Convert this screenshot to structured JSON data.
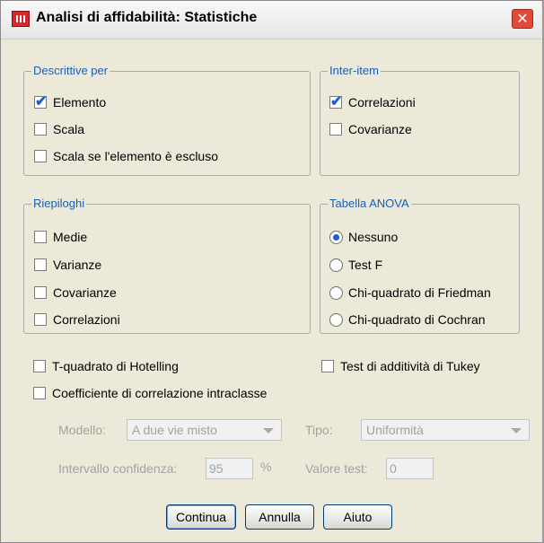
{
  "window": {
    "title": "Analisi di affidabilità: Statistiche"
  },
  "groups": {
    "descrittive": {
      "legend": "Descrittive per",
      "items": [
        {
          "label": "Elemento",
          "checked": true
        },
        {
          "label": "Scala",
          "checked": false
        },
        {
          "label": "Scala se l'elemento è escluso",
          "checked": false
        }
      ]
    },
    "interitem": {
      "legend": "Inter-item",
      "items": [
        {
          "label": "Correlazioni",
          "checked": true
        },
        {
          "label": "Covarianze",
          "checked": false
        }
      ]
    },
    "riepiloghi": {
      "legend": "Riepiloghi",
      "items": [
        {
          "label": "Medie",
          "checked": false
        },
        {
          "label": "Varianze",
          "checked": false
        },
        {
          "label": "Covarianze",
          "checked": false
        },
        {
          "label": "Correlazioni",
          "checked": false
        }
      ]
    },
    "anova": {
      "legend": "Tabella ANOVA",
      "items": [
        {
          "label": "Nessuno",
          "selected": true
        },
        {
          "label": "Test F",
          "selected": false
        },
        {
          "label": "Chi-quadrato di Friedman",
          "selected": false
        },
        {
          "label": "Chi-quadrato di Cochran",
          "selected": false
        }
      ]
    }
  },
  "options": {
    "hotelling": {
      "label": "T-quadrato di Hotelling",
      "checked": false
    },
    "tukey": {
      "label": "Test di additività di Tukey",
      "checked": false
    },
    "intraclass": {
      "label": "Coefficiente di correlazione intraclasse",
      "checked": false
    }
  },
  "intraclass": {
    "modello_label": "Modello:",
    "modello_value": "A due vie misto",
    "tipo_label": "Tipo:",
    "tipo_value": "Uniformità",
    "intervallo_label": "Intervallo confidenza:",
    "intervallo_value": "95",
    "percent": "%",
    "valore_label": "Valore test:",
    "valore_value": "0"
  },
  "buttons": {
    "continua": "Continua",
    "annulla": "Annulla",
    "aiuto": "Aiuto"
  },
  "colors": {
    "accent": "#1d5fd0",
    "legend": "#1a5fb4",
    "disabled": "#a2a2a2",
    "close": "#e04a3a"
  }
}
